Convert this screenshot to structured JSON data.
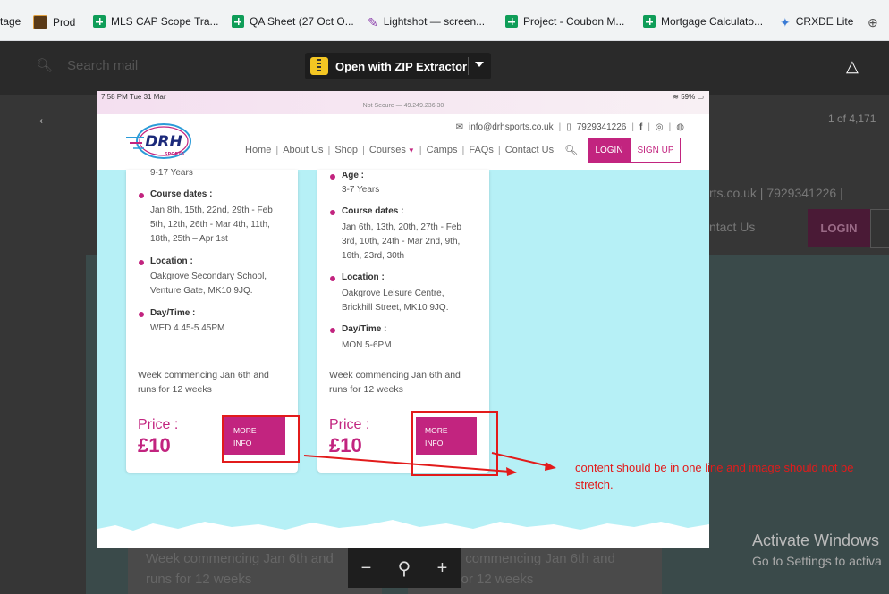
{
  "bookmarks": [
    {
      "label": "tage",
      "icon": "none"
    },
    {
      "label": "Prod",
      "icon": "prod-icon"
    },
    {
      "label": "MLS CAP Scope Tra...",
      "icon": "sheets-icon"
    },
    {
      "label": "QA Sheet (27 Oct O...",
      "icon": "sheets-icon"
    },
    {
      "label": "Lightshot — screen...",
      "icon": "feather-icon"
    },
    {
      "label": "Project - Coubon M...",
      "icon": "sheets-icon"
    },
    {
      "label": "Mortgage Calculato...",
      "icon": "sheets-icon"
    },
    {
      "label": "CRXDE Lite",
      "icon": "crx-icon"
    }
  ],
  "gmail": {
    "search_placeholder": "Search mail",
    "page_count": "1 of 4,171"
  },
  "zip_extractor": {
    "label": "Open with ZIP Extractor"
  },
  "phone": {
    "status": {
      "time": "7:58 PM  Tue 31 Mar",
      "battery": "59%",
      "url": "Not Secure — 49.249.236.30"
    },
    "contact": {
      "email": "info@drhsports.co.uk",
      "phone": "7929341226"
    },
    "nav": [
      "Home",
      "About Us",
      "Shop",
      "Courses",
      "Camps",
      "FAQs",
      "Contact Us"
    ],
    "login": "LOGIN",
    "signup": "SIGN UP",
    "logo_text": "DRH",
    "logo_sub": "SPORTS",
    "cards": [
      {
        "age_value": "9-17 Years",
        "dates_label": "Course dates :",
        "dates_lines": [
          "Jan 8th, 15th, 22nd, 29th - Feb",
          "5th, 12th, 26th - Mar 4th, 11th,",
          "18th, 25th – Apr 1st"
        ],
        "location_label": "Location :",
        "location_lines": [
          "Oakgrove Secondary School,",
          "Venture Gate, MK10 9JQ."
        ],
        "daytime_label": "Day/Time :",
        "daytime_value": "WED 4.45-5.45PM",
        "week_lines": [
          "Week commencing Jan 6th and",
          "runs for 12 weeks"
        ],
        "price_label": "Price :",
        "price": "£10",
        "more_lines": [
          "MORE",
          "INFO"
        ]
      },
      {
        "age_label": "Age :",
        "age_value": "3-7 Years",
        "dates_label": "Course dates :",
        "dates_lines": [
          "Jan 6th, 13th, 20th, 27th - Feb",
          "3rd, 10th, 24th - Mar 2nd, 9th,",
          "16th, 23rd, 30th"
        ],
        "location_label": "Location :",
        "location_lines": [
          "Oakgrove Leisure Centre,",
          "Brickhill Street, MK10 9JQ."
        ],
        "daytime_label": "Day/Time :",
        "daytime_value": "MON 5-6PM",
        "week_lines": [
          "Week commencing Jan 6th and",
          "runs for 12 weeks"
        ],
        "price_label": "Price :",
        "price": "£10",
        "more_lines": [
          "MORE",
          "INFO"
        ]
      }
    ]
  },
  "annotation": {
    "note": "content should be in one line  and image should not be stretch.",
    "color": "#e21b1b"
  },
  "background": {
    "ghost_contact": "rts.co.uk  |  7929341226  |",
    "ghost_nav": "ntact Us",
    "ghost_login": "LOGIN",
    "ghost_week_lines": [
      "Week commencing Jan 6th and",
      "runs for 12 weeks"
    ],
    "ghost_week_lines_right": [
      "Week commencing Jan 6th and",
      "runs for 12 weeks"
    ],
    "activate_title": "Activate Windows",
    "activate_sub": "Go to Settings to activa"
  },
  "zoom": {
    "minus": "−",
    "zoom": "⚲",
    "plus": "+"
  },
  "colors": {
    "brand": "#c2247f",
    "page_bg": "#b6f0f6",
    "annotation": "#e21b1b"
  }
}
